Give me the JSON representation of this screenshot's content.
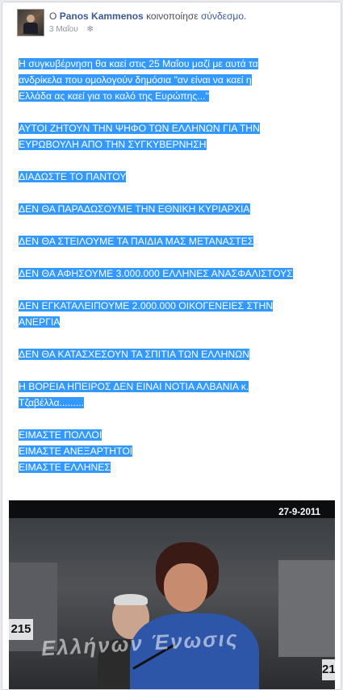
{
  "post": {
    "intro_word": "Ο",
    "author": "Panos Kammenos",
    "action": "κοινοποίησε",
    "object": "σύνδεσμο.",
    "date": "3 Μαΐου",
    "paragraphs": [
      [
        "Η συγκυβέρνηση θα καεί στις 25 Μαΐου μαζί με αυτά τα",
        "ανδρίκελα που ομολογούν δημόσια \"αν είναι να καεί η",
        "Ελλάδα ας καεί για το καλό της Ευρώπης...\""
      ],
      [
        "ΑΥΤΟΙ ΖΗΤΟΥΝ ΤΗΝ ΨΗΦΟ ΤΩΝ ΕΛΛΗΝΩΝ ΓΙΑ ΤΗΝ",
        "ΕΥΡΩΒΟΥΛΗ ΑΠΟ ΤΗΝ ΣΥΓΚΥΒΕΡΝΗΣΗ"
      ],
      [
        "ΔΙΑΔΩΣΤΕ ΤΟ ΠΑΝΤΟΥ"
      ],
      [
        "ΔΕΝ ΘΑ ΠΑΡΑΔΩΣΟΥΜΕ ΤΗΝ ΕΘΝΙΚΗ ΚΥΡΙΑΡΧΙΑ"
      ],
      [
        "ΔΕΝ ΘΑ ΣΤΕΙΛΟΥΜΕ ΤΑ ΠΑΙΔΙΑ ΜΑΣ ΜΕΤΑΝΑΣΤΕΣ"
      ],
      [
        "ΔΕΝ ΘΑ ΑΦΗΣΟΥΜΕ 3.000.000 ΕΛΛΗΝΕΣ ΑΝΑΣΦΑΛΙΣΤΟΥΣ"
      ],
      [
        "ΔΕΝ ΕΓΚΑΤΑΛΕΙΠΟΥΜΕ 2.000.000 ΟΙΚΟΓΕΝΕΙΕΣ ΣΤΗΝ",
        "ΑΝΕΡΓΙΑ"
      ],
      [
        "ΔΕΝ ΘΑ ΚΑΤΑΣΧΕΣΟΥΝ ΤΑ ΣΠΙΤΙΑ ΤΩΝ ΕΛΛΗΝΩΝ"
      ],
      [
        "Η ΒΟΡΕΙΑ ΗΠΕΙΡΟΣ ΔΕΝ ΕΙΝΑΙ ΝΟΤΙΑ ΑΛΒΑΝΙΑ κ.",
        "Τζαβέλλα........."
      ],
      [
        "ΕΙΜΑΣΤΕ ΠΟΛΛΟΙ",
        "ΕΙΜΑΣΤΕ ΑΝΕΞΑΡΤΗΤΟΙ",
        "ΕΙΜΑΣΤΕ ΕΛΛΗΝΕΣ"
      ]
    ]
  },
  "video": {
    "datestamp": "27-9-2011",
    "nameplate_left": "215",
    "nameplate_right": "21",
    "watermark": "Ελλήνων Ένωσις"
  },
  "icons": {
    "privacy": "gear-icon",
    "avatar": "profile-photo"
  },
  "colors": {
    "highlight": "#3399ff",
    "link": "#3b5998"
  }
}
